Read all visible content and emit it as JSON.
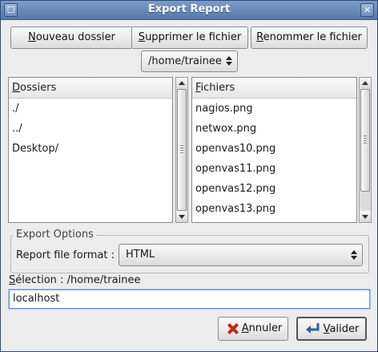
{
  "window": {
    "title": "Export Report",
    "menu_glyph": "☐",
    "close_glyph": "✕"
  },
  "toolbar": {
    "new_folder": {
      "mnemonic": "N",
      "rest": "ouveau dossier"
    },
    "delete_file": {
      "mnemonic": "S",
      "rest": "upprimer le fichier"
    },
    "rename_file": {
      "mnemonic": "R",
      "rest": "enommer le fichier"
    }
  },
  "path_combo": {
    "value": "/home/trainee"
  },
  "folders": {
    "header_mnemonic": "D",
    "header_rest": "ossiers",
    "items": [
      "./",
      "../",
      "Desktop/"
    ]
  },
  "files": {
    "header_mnemonic": "F",
    "header_rest": "ichiers",
    "items": [
      "nagios.png",
      "netwox.png",
      "openvas10.png",
      "openvas11.png",
      "openvas12.png",
      "openvas13.png"
    ]
  },
  "export_options": {
    "group_label": "Export Options",
    "format_label": "Report file format :",
    "format_value": "HTML"
  },
  "selection": {
    "label_mnemonic": "S",
    "label_rest": "élection : /home/trainee",
    "value": "localhost"
  },
  "actions": {
    "cancel": {
      "mnemonic": "A",
      "rest": "nnuler"
    },
    "ok": {
      "mnemonic": "V",
      "rest": "alider"
    }
  },
  "colors": {
    "title_bar": "#6887b6",
    "cancel_icon": "#c4271c",
    "ok_icon": "#2f5f9e"
  }
}
